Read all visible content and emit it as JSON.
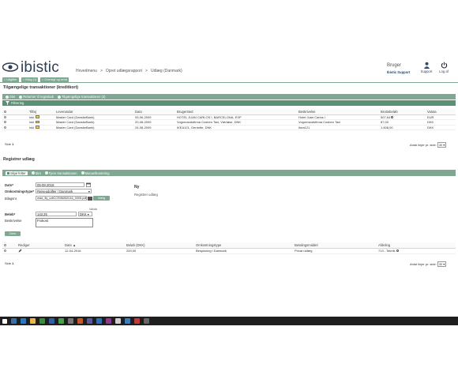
{
  "header": {
    "logo_text": "ibistic",
    "breadcrumbs": [
      "Hovedmenu",
      ">",
      "Opret udlægsrapport",
      ">",
      "Udlæg (Danmark)"
    ],
    "user_label": "Bruger",
    "user_name": "Ibistic Support",
    "support_label": "Support",
    "logout_label": "Log af"
  },
  "tabs": [
    "< Udgifter",
    "> Bilag (1)",
    "> Oversigt og send"
  ],
  "transactions": {
    "title": "Tilgængelige transaktioner (kreditkort)",
    "toolbar": [
      "Slet",
      "Returner til regnskab",
      "Tilgængelige transaktioner (3)"
    ],
    "filter_label": "Filtrering",
    "columns": [
      "",
      "Tilføj",
      "Leverandør",
      "Dato",
      "Brugersted",
      "Beskrivelse",
      "Bruttobeløb",
      "Valuta"
    ],
    "rows": [
      {
        "add": "inkl.",
        "vendor": "Master Card (DanskeBank)",
        "date": "05-06-2009",
        "place": "HOTEL JUAN CARLOS I, BARCELONA, ESP",
        "description": "Hotel Juan Carlos I",
        "amount": "507,64",
        "currency": "EUR"
      },
      {
        "add": "inkl.",
        "vendor": "Master Card (DanskeBank)",
        "date": "20-08-2009",
        "place": "Vognmandsfirma Cosben Taxi, Værløse, DNK",
        "description": "Vognmandsfirma Cosben Taxi",
        "amount": "87,00",
        "currency": "DKK"
      },
      {
        "add": "inkl.",
        "vendor": "Master Card (DanskeBank)",
        "date": "24-08-2009",
        "place": "IKEA121, Gentofte, DNK",
        "description": "Ikea121",
        "amount": "1.608,00",
        "currency": "DKK"
      }
    ],
    "page_label": "Side",
    "page_num": "1",
    "per_page_label": "Antal linjer pr. side:",
    "per_page_value": "30"
  },
  "register": {
    "title": "Registrer udlæg",
    "toolbar": [
      "Skjul felter",
      "Slet",
      "Fjern transaktionen",
      "Manuelkontering"
    ],
    "date_label": "Dato*",
    "date_value": "05-08-2016",
    "type_label": "Omkostningstype*",
    "type_value": "Rejseudgifter / Danmark",
    "attachment_label": "Bilagsnr.",
    "attachment_value": "mad_fly_udlCCR06052016_0005.pdf",
    "attachment_button": "Vælg",
    "amount_label": "Beløb*",
    "amount_value": "143,25",
    "currency_caption": "Valuta",
    "currency_value": "DKK",
    "desc_label": "Beskrivelse",
    "desc_value": "Frokost",
    "save_button": "Gem",
    "status_title": "Ny",
    "status_sub": "Registrer udlæg"
  },
  "expenses": {
    "columns": [
      "",
      "Rediger",
      "Dato",
      "Beløb (DKK)",
      "Omkostningstype",
      "Betalingsmiddel",
      "Afdeling"
    ],
    "rows": [
      {
        "date": "12-04-2016",
        "amount": "200,00",
        "type": "Bespisning i Danmark",
        "payment": "Privat udlæg",
        "dept": "713 - Teknik"
      }
    ],
    "page_label": "Side",
    "page_num": "1",
    "per_page_label": "Antal linjer pr. side:",
    "per_page_value": "30"
  },
  "colors": {
    "accent": "#7fa792",
    "accent_dark": "#5c8f73",
    "logo": "#2f3f55",
    "taskbar": "#1f1f1f"
  }
}
